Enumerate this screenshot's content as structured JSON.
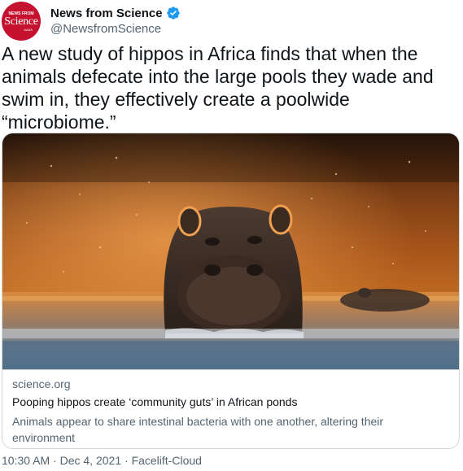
{
  "author": {
    "avatar_top": "NEWS FROM",
    "avatar_main": "Science",
    "avatar_bottom": "AAAS",
    "display_name": "News from Science",
    "handle": "@NewsfromScience",
    "verified_icon": "verified-badge-icon",
    "accent_color": "#1d9bf0",
    "brand_color": "#c4122f"
  },
  "tweet": {
    "text": "A new study of hippos in Africa finds that when the animals defecate into the large pools they wade and swim in, they effectively create a poolwide “microbiome.”"
  },
  "card": {
    "domain": "science.org",
    "title": "Pooping hippos create ‘community guts’ in African ponds",
    "description": "Animals appear to share intestinal bacteria with one another, altering their environment"
  },
  "footer": {
    "time": "10:30 AM",
    "date": "Dec 4, 2021",
    "source": "Facelift-Cloud",
    "separator": " · "
  }
}
